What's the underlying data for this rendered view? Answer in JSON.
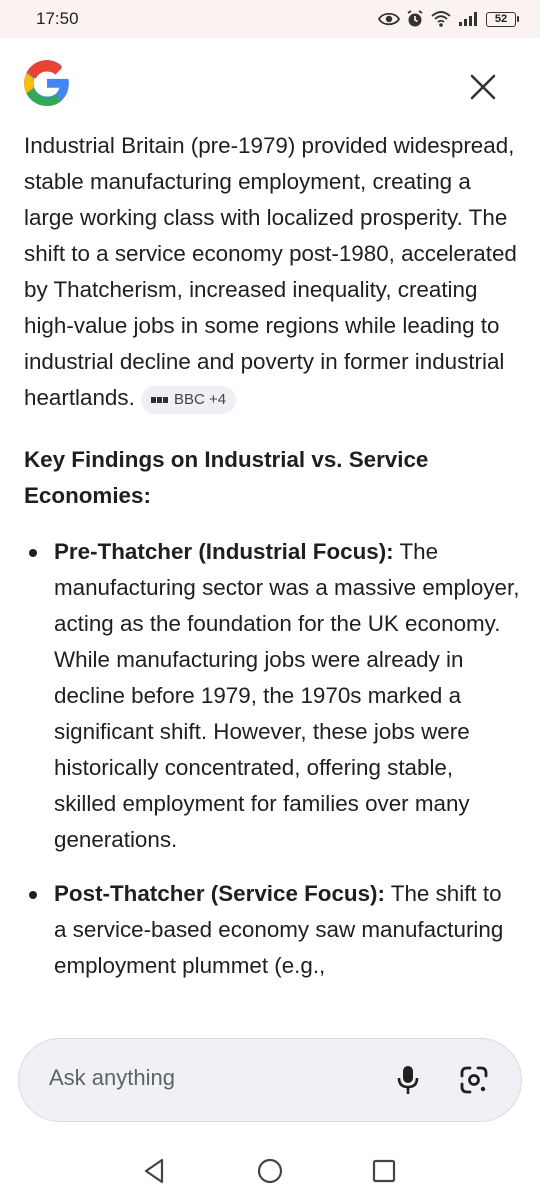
{
  "status_bar": {
    "time": "17:50",
    "battery": "52"
  },
  "icons": {
    "google": "google-g-icon",
    "close": "close-icon",
    "mic": "mic-icon",
    "lens": "google-lens-icon",
    "back": "back-triangle-icon",
    "home": "home-circle-icon",
    "recents": "recents-square-icon"
  },
  "colors": {
    "blue": "#4285F4",
    "red": "#EA4335",
    "yellow": "#FBBC05",
    "green": "#34A853"
  },
  "content": {
    "intro": "Industrial Britain (pre-1979) provided widespread, stable manufacturing employment, creating a large working class with localized prosperity. The shift to a service economy post-1980, accelerated by Thatcherism, increased inequality, creating high-value jobs in some regions while leading to industrial decline and poverty in former industrial heartlands.",
    "source_chip": "BBC +4",
    "heading": "Key Findings on Industrial vs. Service Economies:",
    "bullets": [
      {
        "title": "Pre-Thatcher (Industrial Focus):",
        "text": " The manufacturing sector was a massive employer, acting as the foundation for the UK economy. While manufacturing jobs were already in decline before 1979, the 1970s marked a significant shift. However, these jobs were historically concentrated, offering stable, skilled employment for families over many generations."
      },
      {
        "title": "Post-Thatcher (Service Focus):",
        "text": " The shift to a service-based economy saw manufacturing employment plummet (e.g.,"
      }
    ]
  },
  "ask_bar": {
    "placeholder": "Ask anything"
  }
}
